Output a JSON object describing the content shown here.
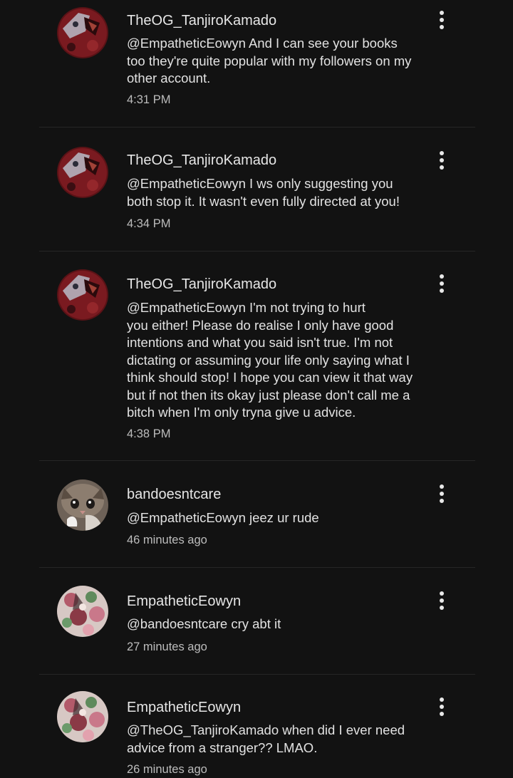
{
  "comments": [
    {
      "author": "TheOG_TanjiroKamado",
      "lines": [
        "@EmpatheticEowyn  And I can see your books",
        "too they're quite popular with my followers on my",
        "other account."
      ],
      "time": "4:31 PM",
      "avatar": "tanjiro-avatar-icon"
    },
    {
      "author": "TheOG_TanjiroKamado",
      "lines": [
        "@EmpatheticEowyn  I ws only suggesting you",
        "both stop it. It wasn't even fully directed at you!"
      ],
      "time": "4:34 PM",
      "avatar": "tanjiro-avatar-icon"
    },
    {
      "author": "TheOG_TanjiroKamado",
      "lines": [
        "@EmpatheticEowyn  I'm not trying to hurt",
        "you either! Please do realise I only have good",
        "intentions and what you said isn't true. I'm not",
        "dictating or assuming your life only saying what I",
        "think should stop! I hope you can view it that way",
        "but if not then its okay just please don't call me a",
        "bitch when I'm only tryna give u advice."
      ],
      "time": "4:38 PM",
      "avatar": "tanjiro-avatar-icon"
    },
    {
      "author": "bandoesntcare",
      "lines": [
        "@EmpatheticEowyn jeez ur rude"
      ],
      "time": "46 minutes ago",
      "avatar": "kitten-avatar-icon"
    },
    {
      "author": "EmpatheticEowyn",
      "lines": [
        "@bandoesntcare cry abt it"
      ],
      "time": "27 minutes ago",
      "avatar": "floral-avatar-icon"
    },
    {
      "author": "EmpatheticEowyn",
      "lines": [
        "@TheOG_TanjiroKamado when did I ever need",
        "advice from a stranger?? LMAO."
      ],
      "time": "26 minutes ago",
      "avatar": "floral-avatar-icon"
    }
  ],
  "icons": {
    "more": "more-vertical-icon"
  },
  "colors": {
    "background": "#121212",
    "text": "#e2e2e2",
    "secondary_text": "#bdbdbd",
    "divider": "#262626"
  }
}
